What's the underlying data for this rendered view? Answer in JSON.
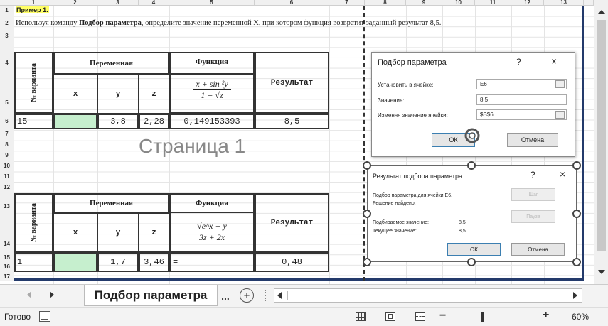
{
  "columns": [
    "1",
    "2",
    "3",
    "4",
    "5",
    "6",
    "7",
    "8",
    "9",
    "10",
    "11",
    "12",
    "13"
  ],
  "rows": [
    "1",
    "2",
    "3",
    "4",
    "5",
    "6",
    "7",
    "8",
    "9",
    "10",
    "11",
    "12",
    "13",
    "14",
    "15",
    "16",
    "17"
  ],
  "a1_text": "Пример 1.",
  "instruction": {
    "pre": "Используя команду ",
    "bold": "Подбор параметра",
    "post": ", определите значение переменной X, при котором функция возвратит заданный результат 8,5."
  },
  "page_label": "Страница 1",
  "table1": {
    "variant_label": "№ варианта",
    "variable_header": "Переменная",
    "function_header": "Функция",
    "result_header": "Результат",
    "col_x": "x",
    "col_y": "y",
    "col_z": "z",
    "formula_num": "x + sin ²y",
    "formula_den": "1 + √z",
    "row": {
      "n": "15",
      "x": "",
      "y": "3,8",
      "z": "2,28",
      "f": "0,149153393",
      "r": "8,5"
    }
  },
  "table2": {
    "variant_label": "№ варианта",
    "variable_header": "Переменная",
    "function_header": "Функция",
    "result_header": "Результат",
    "col_x": "x",
    "col_y": "y",
    "col_z": "z",
    "formula_num": "√e^x + y",
    "formula_den": "3z + 2x",
    "row": {
      "n": "1",
      "x": "",
      "y": "1,7",
      "z": "3,46",
      "f": "=",
      "r": "0,48"
    }
  },
  "dialog1": {
    "title": "Подбор параметра",
    "help": "?",
    "close": "×",
    "set_cell_label": "Установить в ячейке:",
    "set_cell_value": "E6",
    "value_label": "Значение:",
    "value_value": "8,5",
    "changing_label": "Изменяя значение ячейки:",
    "changing_value": "$B$6",
    "ok": "ОК",
    "cancel": "Отмена"
  },
  "dialog2": {
    "title": "Результат подбора параметра",
    "help": "?",
    "close": "×",
    "line1": "Подбор параметра для ячейки E6.",
    "line2": "Решение найдено.",
    "target_label": "Подбираемое значение:",
    "target_value": "8,5",
    "current_label": "Текущее значение:",
    "current_value": "8,5",
    "step": "Шаг",
    "pause": "Пауза",
    "ok": "ОК",
    "cancel": "Отмена"
  },
  "sheet_tab": "Подбор параметра",
  "tab_ellipsis": "...",
  "add_sheet": "+",
  "status": "Готово",
  "zoom": "60%",
  "colors": {
    "accent_yellow": "#ffff66",
    "input_green": "#c6efce",
    "page_edge": "#233a6b"
  }
}
